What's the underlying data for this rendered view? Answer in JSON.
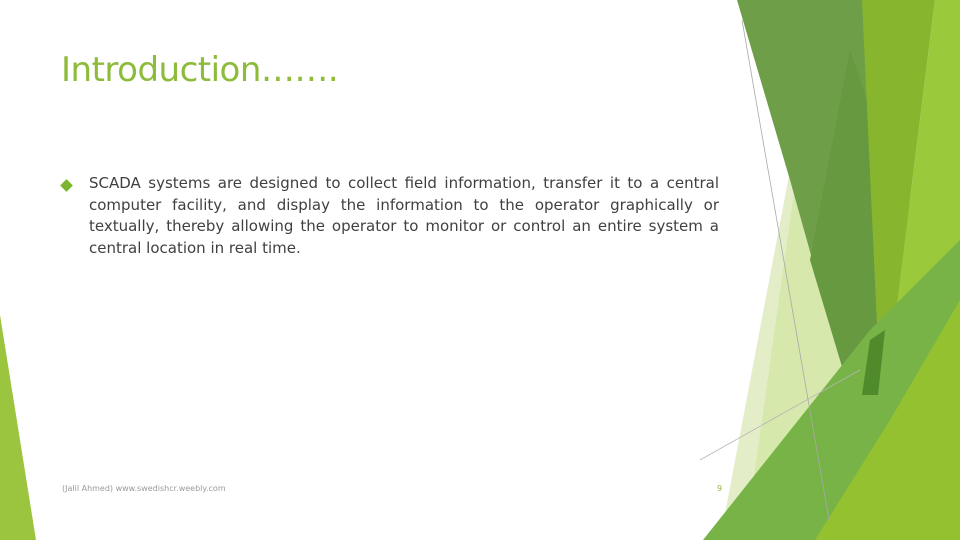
{
  "slide": {
    "title": "Introduction…….",
    "bullets": [
      {
        "icon": "diamond-bullet-icon",
        "text": "SCADA systems are designed to collect field information, transfer it to a central computer facility, and display the information to the operator graphically or textually, thereby allowing the operator to monitor or control an entire system a central location in real time."
      }
    ],
    "footer": "(Jalil Ahmed) www.swedishcr.weebly.com",
    "page_number": "9"
  },
  "theme": {
    "accent": "#8dbb3a",
    "bullet": "#7cb631",
    "text": "#404040"
  }
}
